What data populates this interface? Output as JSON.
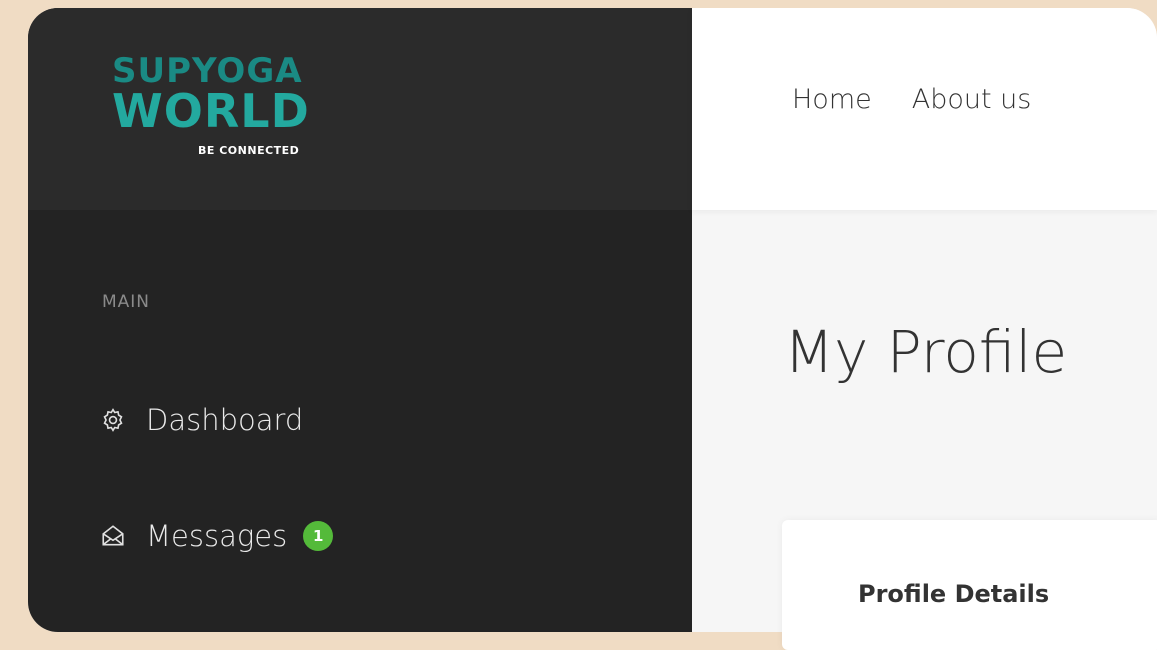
{
  "logo": {
    "line1": "SUPYOGA",
    "line2": "WORLD",
    "line3": "BE CONNECTED"
  },
  "sidebar": {
    "section_label": "MAIN",
    "items": [
      {
        "label": "Dashboard",
        "icon": "gear-icon"
      },
      {
        "label": "Messages",
        "icon": "envelope-open-icon",
        "badge": "1"
      }
    ]
  },
  "topnav": {
    "items": [
      {
        "label": "Home"
      },
      {
        "label": "About us"
      }
    ]
  },
  "page": {
    "title": "My Profile"
  },
  "card": {
    "title": "Profile Details"
  },
  "colors": {
    "sidebar_bg": "#232323",
    "logo_teal": "#23a99f",
    "badge_green": "#54ba3a",
    "page_bg": "#f6f6f6",
    "outer_bg": "#f0dcc4"
  }
}
